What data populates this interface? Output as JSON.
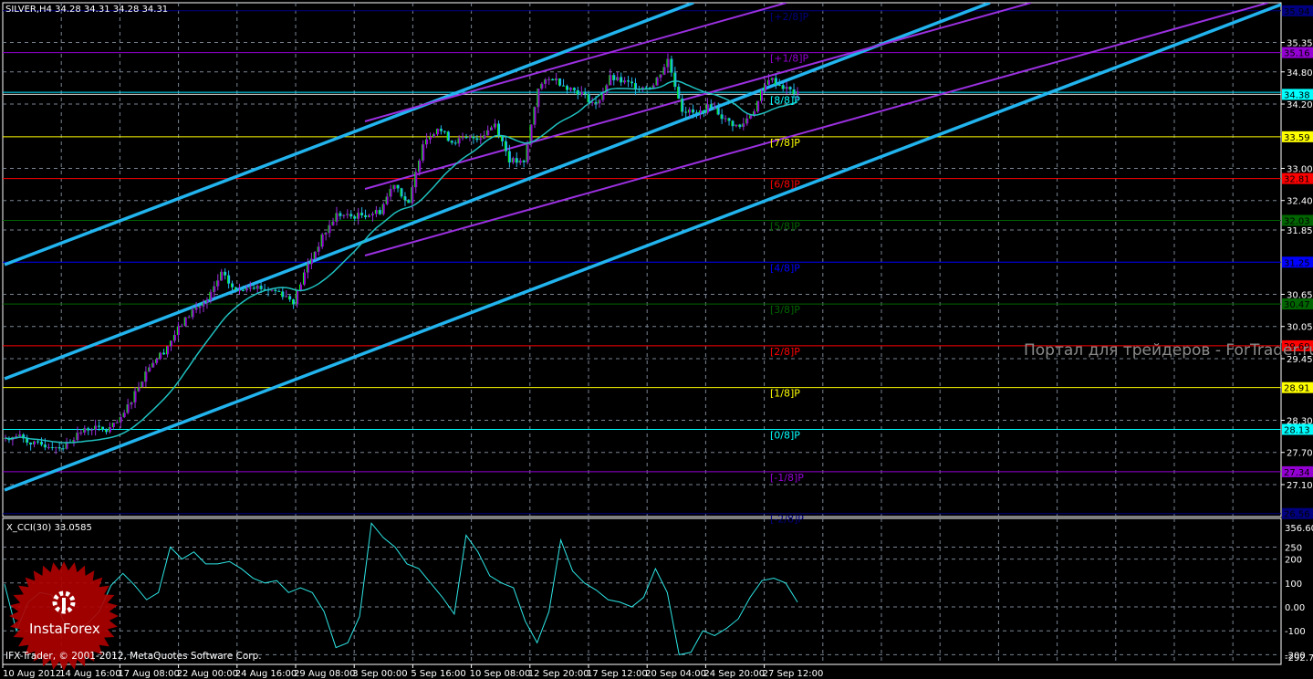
{
  "header": {
    "symbol_line": "SILVER,H4  34.28 34.31 34.28 34.31"
  },
  "watermark": "Портал для трейдеров - ForTrader.ru",
  "logo": {
    "text": "InstaForex",
    "color": "#b00000"
  },
  "copyright": "IFX-Trader, © 2001-2012, MetaQuotes Software Corp.",
  "chart_data": [
    {
      "type": "candlestick",
      "title": "SILVER,H4",
      "ylim": [
        26.56,
        35.94
      ],
      "y_ticks": [
        "35.35",
        "34.80",
        "34.20",
        "33.00",
        "32.40",
        "31.85",
        "30.65",
        "30.05",
        "29.45",
        "28.30",
        "27.70",
        "27.10"
      ],
      "x_ticks": [
        "10 Aug 2012",
        "14 Aug 16:00",
        "17 Aug 08:00",
        "22 Aug 00:00",
        "24 Aug 16:00",
        "29 Aug 08:00",
        "3 Sep 00:00",
        "5 Sep 16:00",
        "10 Sep 08:00",
        "12 Sep 20:00",
        "17 Sep 12:00",
        "20 Sep 04:00",
        "24 Sep 20:00",
        "27 Sep 12:00"
      ],
      "closes": [
        27.97,
        28.0,
        27.85,
        27.83,
        27.8,
        28.05,
        28.17,
        28.1,
        28.3,
        28.82,
        29.33,
        29.59,
        30.0,
        30.35,
        30.52,
        31.03,
        30.7,
        30.83,
        30.75,
        30.7,
        30.52,
        31.2,
        31.71,
        32.14,
        32.1,
        32.14,
        32.2,
        32.74,
        32.31,
        33.5,
        33.76,
        33.5,
        33.55,
        33.59,
        33.84,
        33.16,
        33.08,
        34.52,
        34.69,
        34.52,
        34.4,
        34.18,
        34.69,
        34.6,
        34.52,
        34.55,
        35.03,
        34.1,
        34.01,
        34.18,
        33.9,
        33.76,
        34.1,
        34.69,
        34.52,
        34.38
      ],
      "current_price": "34.38",
      "murrey_levels": [
        {
          "label": "[+2/8]P",
          "price": "35.94",
          "color": "#000080"
        },
        {
          "label": "[+1/8]P",
          "price": "35.16",
          "color": "#9400d3"
        },
        {
          "label": "[8/8]P",
          "price": "34.38",
          "color": "#00ffff"
        },
        {
          "label": "[7/8]P",
          "price": "33.59",
          "color": "#ffff00"
        },
        {
          "label": "[6/8]P",
          "price": "32.81",
          "color": "#ff0000"
        },
        {
          "label": "[5/8]P",
          "price": "32.03",
          "color": "#006400"
        },
        {
          "label": "[4/8]P",
          "price": "31.25",
          "color": "#0000ff"
        },
        {
          "label": "[3/8]P",
          "price": "30.47",
          "color": "#006400"
        },
        {
          "label": "[2/8]P",
          "price": "29.69",
          "color": "#ff0000"
        },
        {
          "label": "[1/8]P",
          "price": "28.91",
          "color": "#ffff00"
        },
        {
          "label": "[0/8]P",
          "price": "28.13",
          "color": "#00ffff"
        },
        {
          "label": "[-1/8]P",
          "price": "27.34",
          "color": "#9400d3"
        },
        {
          "label": "[-2/8]P",
          "price": "26.56",
          "color": "#000080"
        }
      ]
    },
    {
      "type": "line",
      "title": "X_CCI(30) 33.0585",
      "ylim": [
        -292.723,
        356.606
      ],
      "y_ticks": [
        "356.606",
        "250",
        "200",
        "100",
        "0.00",
        "-100",
        "-200",
        "-292.723"
      ],
      "values": [
        95,
        -100,
        20,
        60,
        50,
        -60,
        -90,
        -70,
        -20,
        90,
        140,
        90,
        30,
        60,
        250,
        200,
        230,
        180,
        180,
        190,
        160,
        120,
        100,
        110,
        60,
        80,
        60,
        -20,
        -170,
        -150,
        -40,
        350,
        290,
        250,
        180,
        160,
        100,
        40,
        -30,
        300,
        230,
        130,
        100,
        80,
        -60,
        -150,
        -20,
        280,
        150,
        100,
        70,
        30,
        20,
        0,
        40,
        160,
        60,
        -200,
        -190,
        -100,
        -120,
        -90,
        -50,
        40,
        110,
        120,
        100,
        20
      ]
    }
  ]
}
